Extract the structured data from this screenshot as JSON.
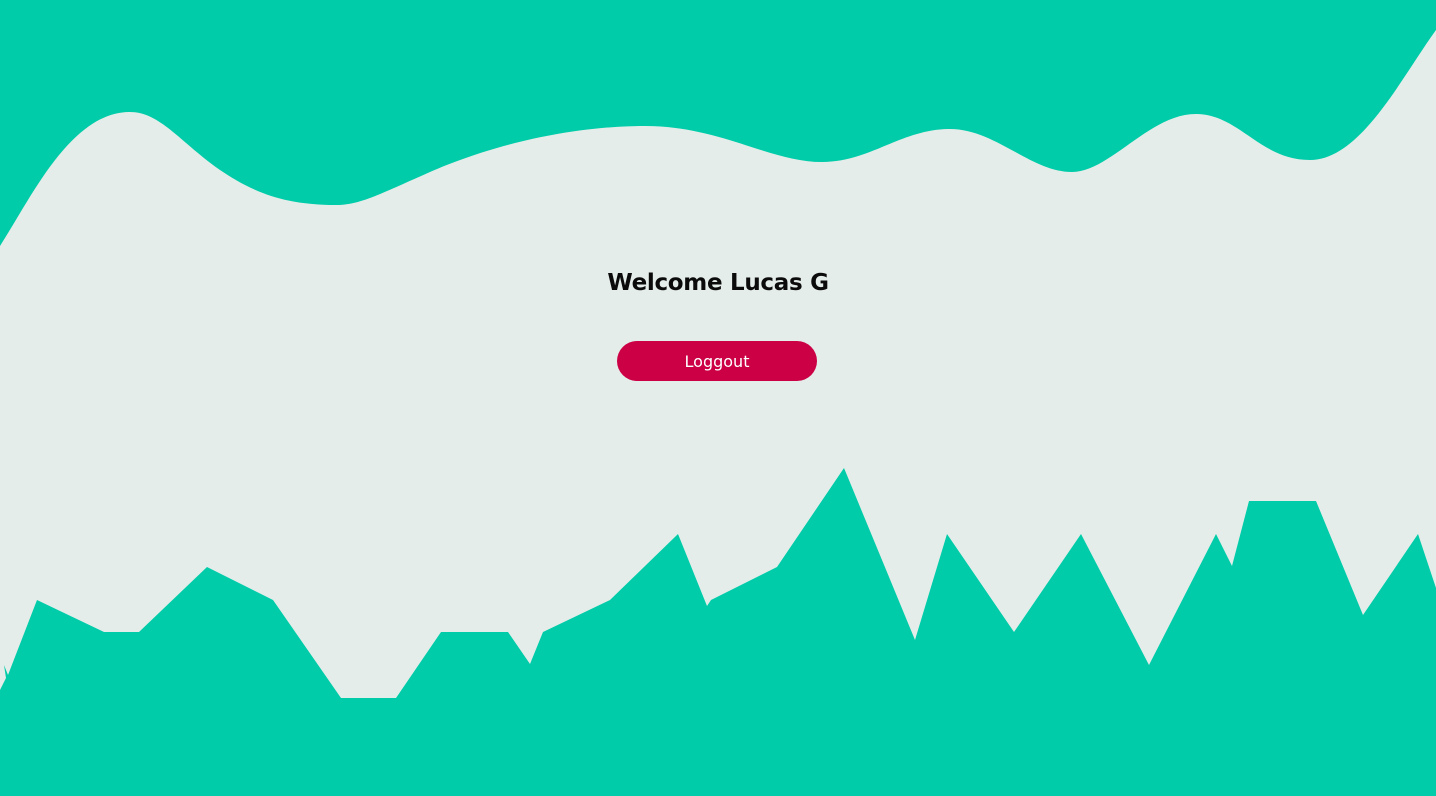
{
  "colors": {
    "background": "#e4ede9",
    "wave": "#00cca9",
    "button": "#cc0044",
    "button_text": "#ffffff",
    "heading_text": "#0b0b0b"
  },
  "header": {
    "welcome_text": "Welcome Lucas G"
  },
  "actions": {
    "logout_label": "Loggout"
  }
}
